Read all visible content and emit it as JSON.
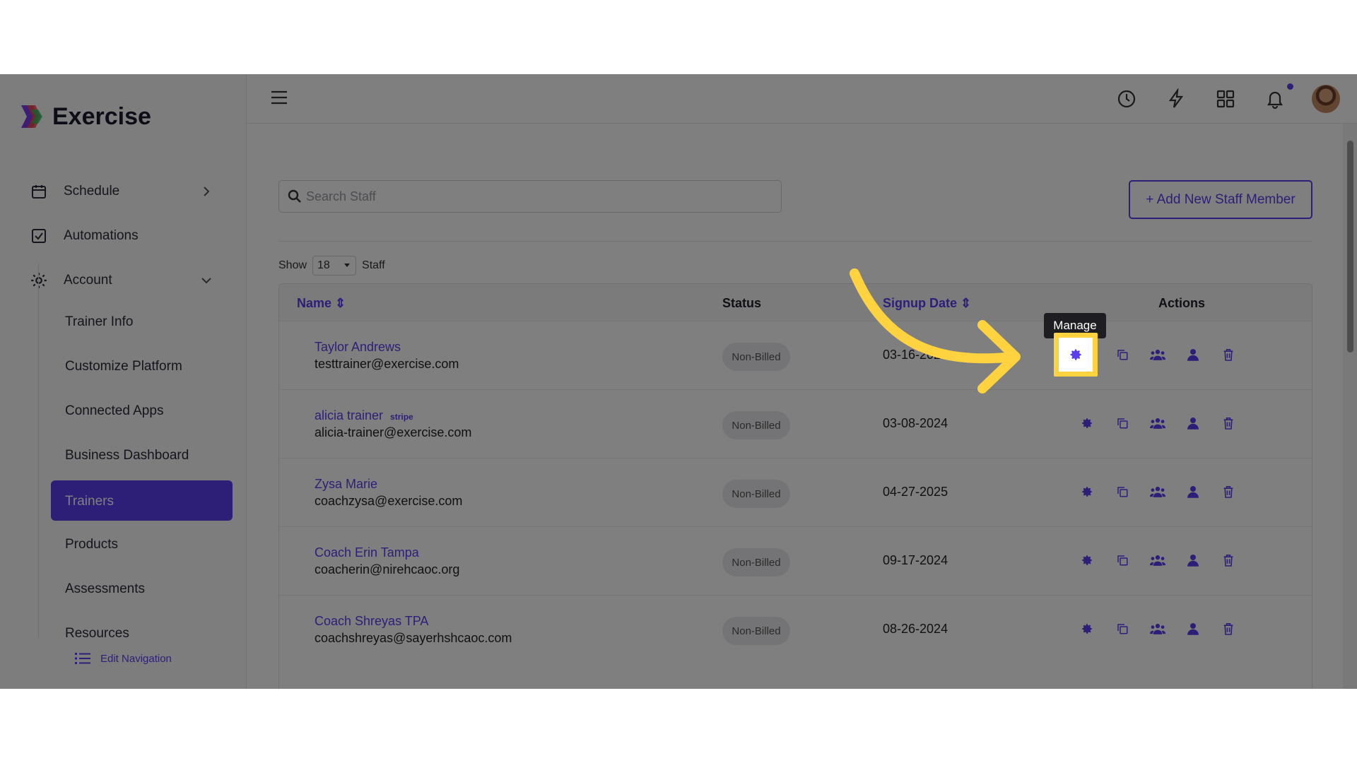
{
  "brand": {
    "name": "Exercise"
  },
  "sidebar": {
    "nav": [
      {
        "label": "Schedule",
        "icon": "calendar-icon"
      },
      {
        "label": "Automations",
        "icon": "checkbox-icon"
      },
      {
        "label": "Account",
        "icon": "gear-icon"
      }
    ],
    "sub_items": [
      "Trainer Info",
      "Customize Platform",
      "Connected Apps",
      "Business Dashboard",
      "Trainers",
      "Products",
      "Assessments",
      "Resources"
    ],
    "active": "Trainers",
    "edit_navigation": "Edit Navigation"
  },
  "topbar": {
    "icons": [
      "history-icon",
      "bolt-icon",
      "grid-icon",
      "bell-icon"
    ]
  },
  "search": {
    "placeholder": "Search Staff"
  },
  "add_button": "+ Add New Staff Member",
  "show": {
    "label_before": "Show",
    "value": "18",
    "label_after": "Staff"
  },
  "table": {
    "headers": {
      "name": "Name ⇕",
      "status": "Status",
      "signup": "Signup Date ⇕",
      "actions": "Actions"
    },
    "rows": [
      {
        "name": "Taylor Andrews",
        "email": "testtrainer@exercise.com",
        "status": "Non-Billed",
        "date": "03-16-2024",
        "stripe": ""
      },
      {
        "name": "alicia trainer",
        "email": "alicia-trainer@exercise.com",
        "status": "Non-Billed",
        "date": "03-08-2024",
        "stripe": "stripe"
      },
      {
        "name": "Zysa Marie",
        "email": "coachzysa@exercise.com",
        "status": "Non-Billed",
        "date": "04-27-2025",
        "stripe": ""
      },
      {
        "name": "Coach Erin Tampa",
        "email": "coacherin@nirehcaoc.org",
        "status": "Non-Billed",
        "date": "09-17-2024",
        "stripe": ""
      },
      {
        "name": "Coach Shreyas TPA",
        "email": "coachshreyas@sayerhshcaoc.com",
        "status": "Non-Billed",
        "date": "08-26-2024",
        "stripe": ""
      }
    ]
  },
  "tooltip": "Manage",
  "colors": {
    "accent": "#5b3ff0",
    "highlight": "#ffd23f"
  }
}
